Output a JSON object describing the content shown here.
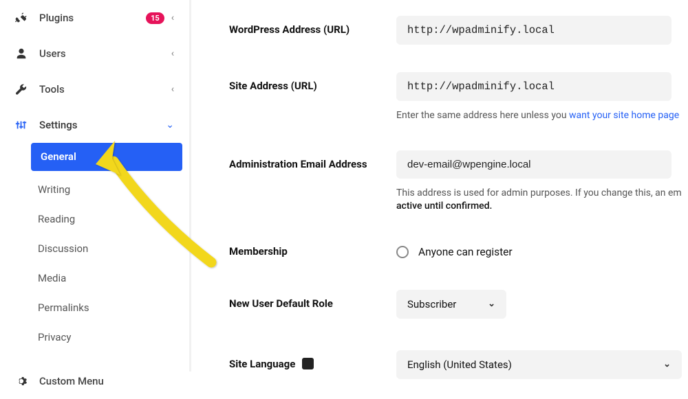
{
  "sidebar": {
    "plugins": {
      "label": "Plugins",
      "badge": "15"
    },
    "users": {
      "label": "Users"
    },
    "tools": {
      "label": "Tools"
    },
    "settings": {
      "label": "Settings",
      "items": [
        {
          "label": "General"
        },
        {
          "label": "Writing"
        },
        {
          "label": "Reading"
        },
        {
          "label": "Discussion"
        },
        {
          "label": "Media"
        },
        {
          "label": "Permalinks"
        },
        {
          "label": "Privacy"
        }
      ]
    },
    "custom_menu": {
      "label": "Custom Menu"
    }
  },
  "main": {
    "wp_address": {
      "label": "WordPress Address (URL)",
      "value": "http://wpadminify.local"
    },
    "site_address": {
      "label": "Site Address (URL)",
      "value": "http://wpadminify.local",
      "help_pre": "Enter the same address here unless you ",
      "help_link": "want your site home page"
    },
    "admin_email": {
      "label": "Administration Email Address",
      "value": "dev-email@wpengine.local",
      "help_pre": "This address is used for admin purposes. If you change this, an em",
      "help_strong": "active until confirmed."
    },
    "membership": {
      "label": "Membership",
      "checkbox_label": "Anyone can register"
    },
    "default_role": {
      "label": "New User Default Role",
      "value": "Subscriber"
    },
    "site_language": {
      "label": "Site Language",
      "value": "English (United States)"
    }
  }
}
